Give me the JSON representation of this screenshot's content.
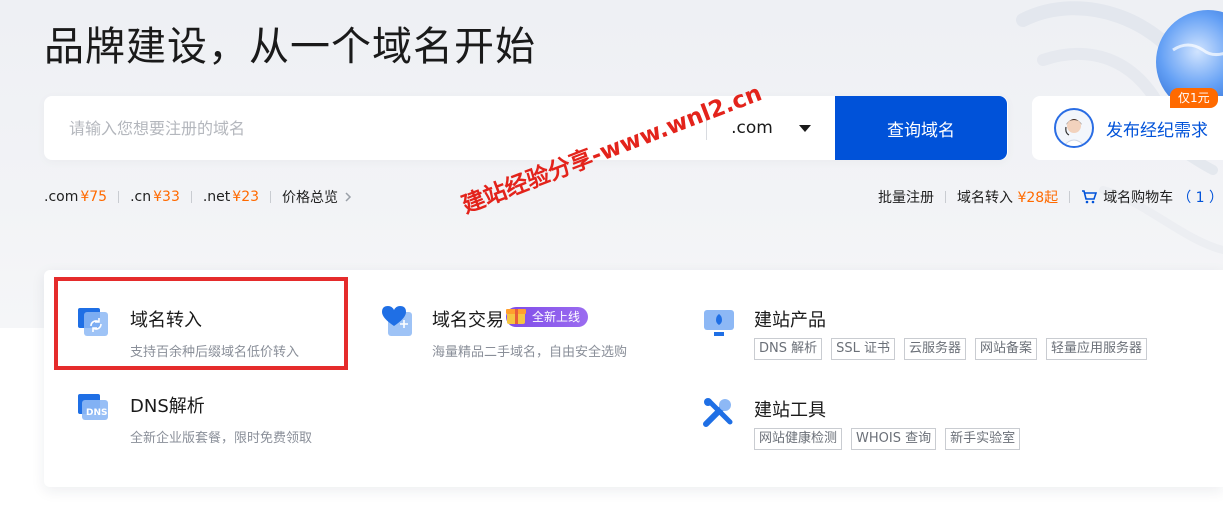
{
  "hero": {
    "title": "品牌建设，从一个域名开始"
  },
  "search": {
    "placeholder": "请输入您想要注册的域名",
    "suffix": ".com",
    "button_label": "查询域名"
  },
  "broker": {
    "label": "发布经纪需求",
    "promo": "仅1元"
  },
  "prices": [
    {
      "ext": ".com",
      "price": "¥75"
    },
    {
      "ext": ".cn",
      "price": "¥33"
    },
    {
      "ext": ".net",
      "price": "¥23"
    }
  ],
  "price_overview": "价格总览",
  "right_links": {
    "bulk": "批量注册",
    "transfer": "域名转入",
    "transfer_price": "¥28起",
    "cart": "域名购物车",
    "cart_count": "（ 1 ）"
  },
  "watermark": "建站经验分享-www.wnl2.cn",
  "services": {
    "transfer": {
      "title": "域名转入",
      "desc": "支持百余种后缀域名低价转入"
    },
    "trade": {
      "title": "域名交易",
      "badge": "全新上线",
      "desc": "海量精品二手域名，自由安全选购"
    },
    "site_products": {
      "title": "建站产品",
      "tags": [
        "DNS 解析",
        "SSL 证书",
        "云服务器",
        "网站备案",
        "轻量应用服务器"
      ]
    },
    "dns": {
      "title": "DNS解析",
      "desc": "全新企业版套餐，限时免费领取"
    },
    "site_tools": {
      "title": "建站工具",
      "tags": [
        "网站健康检测",
        "WHOIS 查询",
        "新手实验室"
      ]
    }
  },
  "colors": {
    "primary": "#0052d9",
    "accent": "#ff6a00",
    "highlight": "#e52b2b",
    "watermark": "#e3231b"
  }
}
